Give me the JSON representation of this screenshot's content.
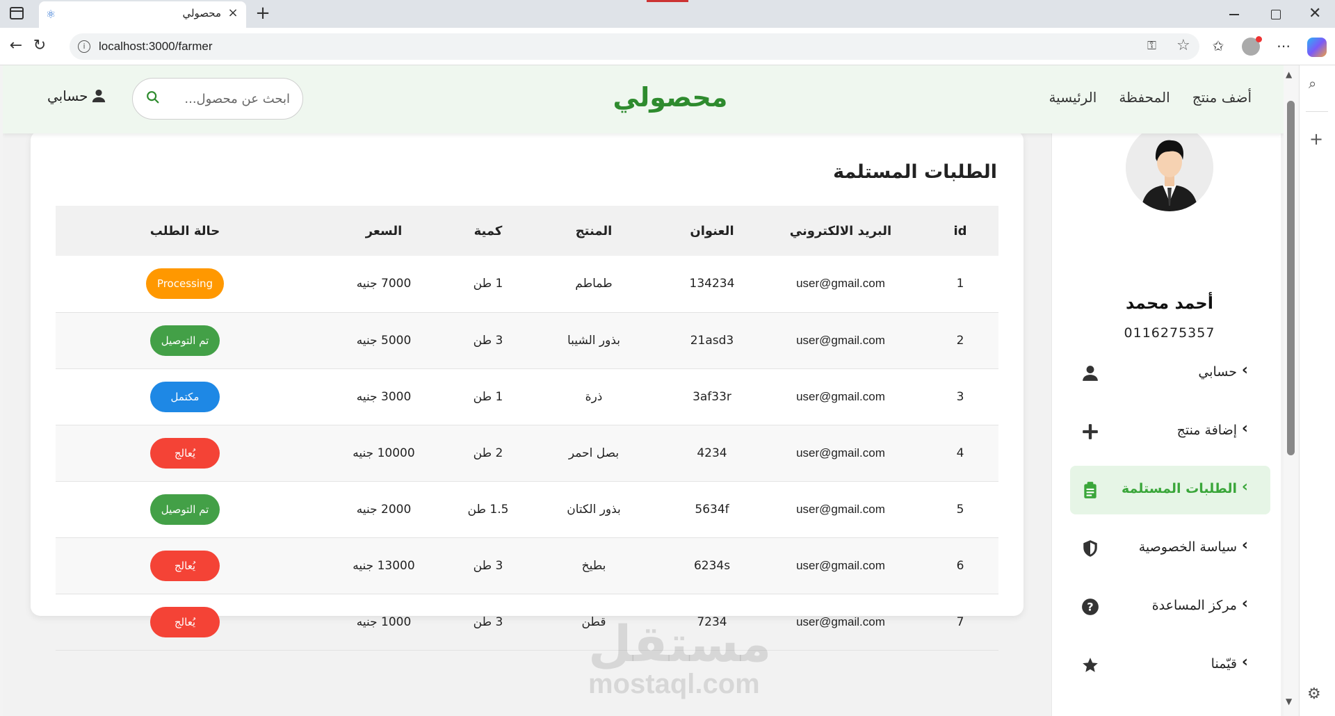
{
  "browser": {
    "tab_title": "محصولي",
    "url": "localhost:3000/farmer"
  },
  "header": {
    "brand": "محصولي",
    "nav": [
      "الرئيسية",
      "المحفظة",
      "أضف منتج"
    ],
    "search_placeholder": "ابحث عن محصول...",
    "account_label": "حسابي"
  },
  "profile": {
    "name": "أحمد محمد",
    "phone": "0116275357",
    "menu": [
      {
        "label": "حسابي",
        "icon": "user-icon",
        "active": false
      },
      {
        "label": "إضافة منتج",
        "icon": "plus-icon",
        "active": false
      },
      {
        "label": "الطلبات المستلمة",
        "icon": "clipboard-icon",
        "active": true
      },
      {
        "label": "سياسة الخصوصية",
        "icon": "shield-icon",
        "active": false
      },
      {
        "label": "مركز المساعدة",
        "icon": "question-icon",
        "active": false
      },
      {
        "label": "قيّمنا",
        "icon": "star-icon",
        "active": false
      }
    ]
  },
  "orders": {
    "title": "الطلبات المستلمة",
    "columns": [
      "id",
      "البريد الالكتروني",
      "العنوان",
      "المنتج",
      "كمية",
      "السعر",
      "حالة الطلب"
    ],
    "rows": [
      {
        "id": "1",
        "email": "user@gmail.com",
        "address": "134234",
        "product": "طماطم",
        "qty": "1 طن",
        "price": "7000 جنيه",
        "status": "Processing",
        "status_type": "processing"
      },
      {
        "id": "2",
        "email": "user@gmail.com",
        "address": "21asd3",
        "product": "بذور الشيبا",
        "qty": "3 طن",
        "price": "5000 جنيه",
        "status": "تم التوصيل",
        "status_type": "delivered"
      },
      {
        "id": "3",
        "email": "user@gmail.com",
        "address": "3af33r",
        "product": "ذرة",
        "qty": "1 طن",
        "price": "3000 جنيه",
        "status": "مكتمل",
        "status_type": "complete"
      },
      {
        "id": "4",
        "email": "user@gmail.com",
        "address": "4234",
        "product": "بصل احمر",
        "qty": "2 طن",
        "price": "10000 جنيه",
        "status": "يُعالج",
        "status_type": "treating"
      },
      {
        "id": "5",
        "email": "user@gmail.com",
        "address": "5634f",
        "product": "بذور الكتان",
        "qty": "1.5 طن",
        "price": "2000 جنيه",
        "status": "تم التوصيل",
        "status_type": "delivered"
      },
      {
        "id": "6",
        "email": "user@gmail.com",
        "address": "6234s",
        "product": "بطيخ",
        "qty": "3 طن",
        "price": "13000 جنيه",
        "status": "يُعالج",
        "status_type": "treating"
      },
      {
        "id": "7",
        "email": "user@gmail.com",
        "address": "7234",
        "product": "قطن",
        "qty": "3 طن",
        "price": "1000 جنيه",
        "status": "يُعالج",
        "status_type": "treating"
      }
    ]
  },
  "watermark": {
    "arabic": "مستقل",
    "latin": "mostaql.com"
  },
  "colors": {
    "brand_green": "#2e8b2e",
    "active_green": "#3aa63a",
    "processing": "#ff9800",
    "delivered": "#43a047",
    "complete": "#1e88e5",
    "treating": "#f44336"
  }
}
